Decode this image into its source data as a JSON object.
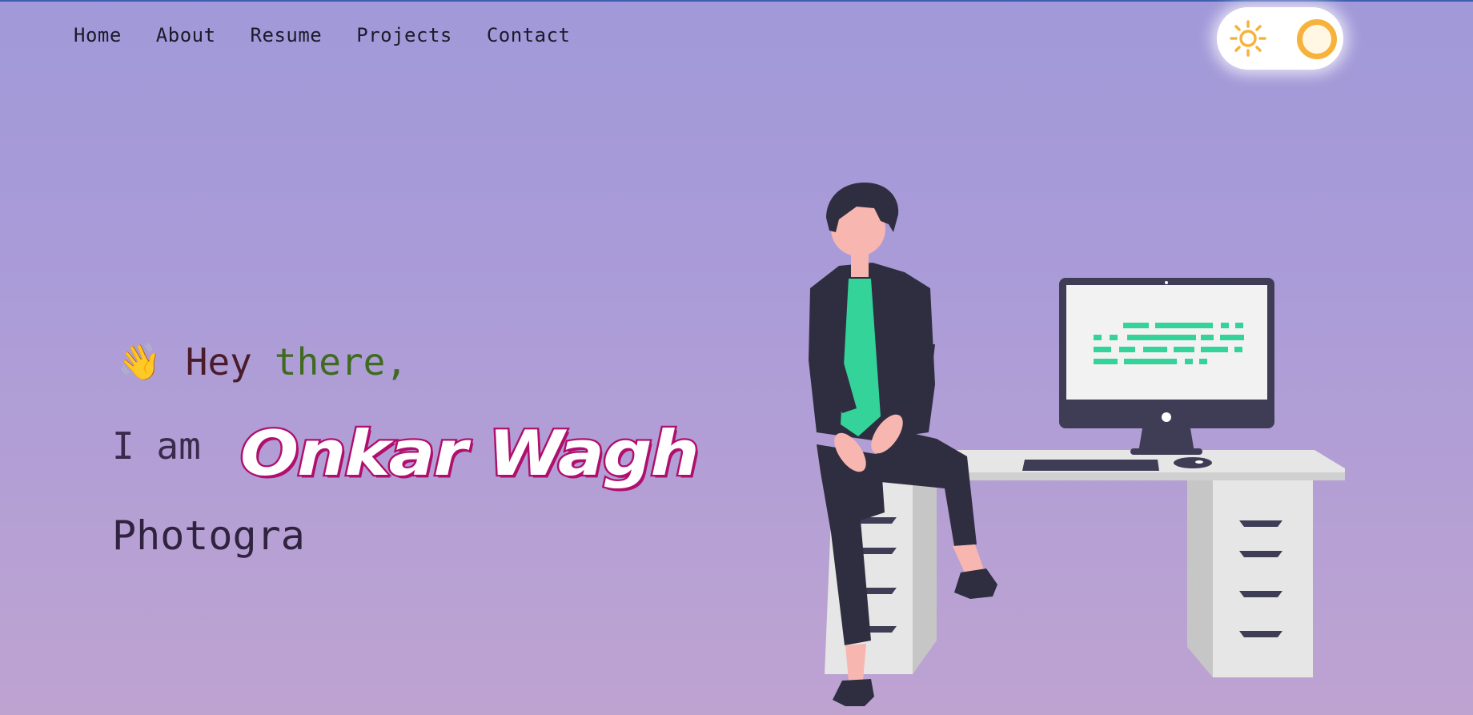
{
  "nav": {
    "items": [
      "Home",
      "About",
      "Resume",
      "Projects",
      "Contact"
    ]
  },
  "theme_toggle": {
    "icon": "sun-icon",
    "state": "light",
    "accent": "#f6b23b"
  },
  "hero": {
    "wave_emoji": "👋",
    "greeting_hey": "Hey",
    "greeting_there": "there,",
    "i_am": "I am",
    "name": "Onkar Wagh",
    "typed_role": "Photogra"
  },
  "colors": {
    "name_outline": "#b00f6e",
    "monitor_code": "#33d39a",
    "shirt": "#33d39a"
  }
}
